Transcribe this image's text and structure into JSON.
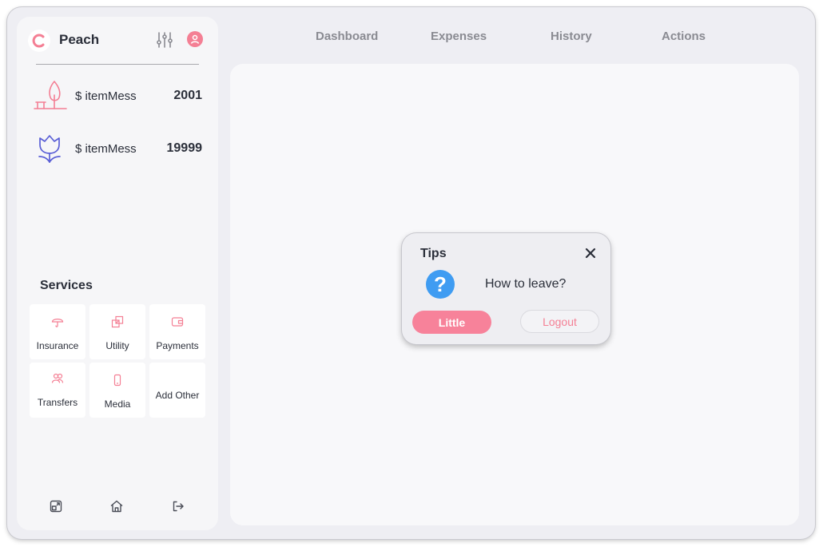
{
  "brand": {
    "name": "Peach",
    "logo_icon": "peach-c-logo-icon",
    "accent": "#f47f94"
  },
  "header": {
    "settings_icon": "sliders-icon",
    "avatar_icon": "user-icon"
  },
  "sidebar": {
    "items": [
      {
        "icon": "tree-bench-icon",
        "label": "$ itemMess",
        "value": "2001",
        "color": "#f47f94"
      },
      {
        "icon": "tulip-icon",
        "label": "$ itemMess",
        "value": "19999",
        "color": "#5a5fd6"
      }
    ],
    "services_title": "Services",
    "services": [
      {
        "icon": "umbrella-icon",
        "label": "Insurance"
      },
      {
        "icon": "grid-icon",
        "label": "Utility"
      },
      {
        "icon": "wallet-icon",
        "label": "Payments"
      },
      {
        "icon": "users-icon",
        "label": "Transfers"
      },
      {
        "icon": "phone-icon",
        "label": "Media"
      },
      {
        "icon": "",
        "label": "Add Other"
      }
    ],
    "footer": [
      "expand-icon",
      "home-icon",
      "logout-icon"
    ]
  },
  "nav": {
    "tabs": [
      "Dashboard",
      "Expenses",
      "History",
      "Actions"
    ]
  },
  "dialog": {
    "title": "Tips",
    "question_icon": "question-icon",
    "question_mark": "?",
    "message": "How to leave?",
    "primary": "Little",
    "secondary": "Logout",
    "primary_color": "#f7829a",
    "icon_color": "#3f9cf2"
  }
}
